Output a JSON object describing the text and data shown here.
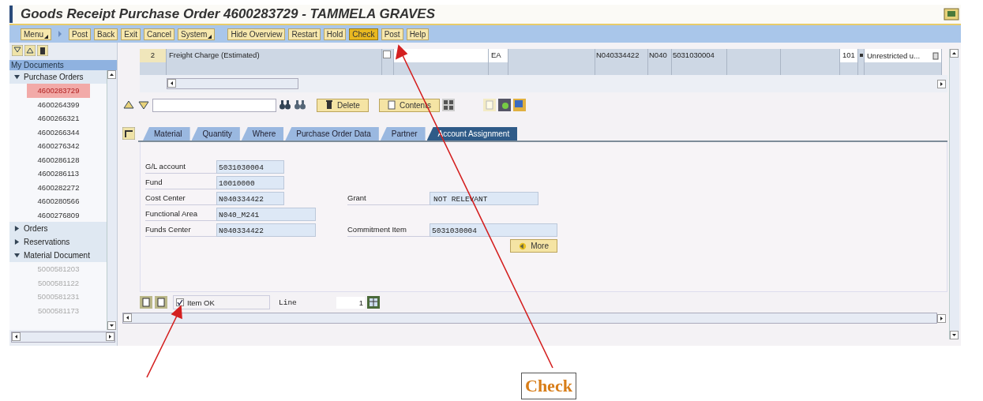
{
  "window": {
    "title": "Goods Receipt Purchase Order 4600283729 - TAMMELA GRAVES"
  },
  "toolbar": [
    {
      "label": "Menu",
      "kind": "menu",
      "selected": false
    },
    {
      "label": "Post",
      "kind": "button",
      "selected": false
    },
    {
      "label": "Back",
      "kind": "button",
      "selected": false
    },
    {
      "label": "Exit",
      "kind": "button",
      "selected": false
    },
    {
      "label": "Cancel",
      "kind": "button",
      "selected": false
    },
    {
      "label": "System",
      "kind": "menu",
      "selected": false
    },
    {
      "label": "Hide Overview",
      "kind": "button",
      "selected": false
    },
    {
      "label": "Restart",
      "kind": "button",
      "selected": false
    },
    {
      "label": "Hold",
      "kind": "button",
      "selected": false
    },
    {
      "label": "Check",
      "kind": "button",
      "selected": true
    },
    {
      "label": "Post",
      "kind": "button",
      "selected": false
    },
    {
      "label": "Help",
      "kind": "button",
      "selected": false
    }
  ],
  "sidebar": {
    "header": "My Documents",
    "tree": [
      {
        "label": "Purchase Orders",
        "expanded": true,
        "children": [
          {
            "label": "4600283729",
            "selected": true,
            "disabled": false
          },
          {
            "label": "4600264399",
            "selected": false,
            "disabled": false
          },
          {
            "label": "4600266321",
            "selected": false,
            "disabled": false
          },
          {
            "label": "4600266344",
            "selected": false,
            "disabled": false
          },
          {
            "label": "4600276342",
            "selected": false,
            "disabled": false
          },
          {
            "label": "4600286128",
            "selected": false,
            "disabled": false
          },
          {
            "label": "4600286113",
            "selected": false,
            "disabled": false
          },
          {
            "label": "4600282272",
            "selected": false,
            "disabled": false
          },
          {
            "label": "4600280566",
            "selected": false,
            "disabled": false
          },
          {
            "label": "4600276809",
            "selected": false,
            "disabled": false
          }
        ]
      },
      {
        "label": "Orders",
        "expanded": false
      },
      {
        "label": "Reservations",
        "expanded": false
      },
      {
        "label": "Material Document",
        "expanded": true,
        "children": [
          {
            "label": "5000581203",
            "selected": false,
            "disabled": true
          },
          {
            "label": "5000581122",
            "selected": false,
            "disabled": true
          },
          {
            "label": "5000581231",
            "selected": false,
            "disabled": true
          },
          {
            "label": "5000581173",
            "selected": false,
            "disabled": true
          }
        ]
      }
    ]
  },
  "item_row": {
    "number": "2",
    "description": "Freight Charge (Estimated)",
    "checked": false,
    "unit": "EA",
    "cost_center": "N040334422",
    "functional_area": "N040",
    "gl_account": "5031030004",
    "movement_type": "101",
    "stock_type": "Unrestricted u..."
  },
  "item_buttons": [
    "Delete",
    "Contents"
  ],
  "tabs": [
    {
      "label": "Material",
      "selected": false
    },
    {
      "label": "Quantity",
      "selected": false
    },
    {
      "label": "Where",
      "selected": false
    },
    {
      "label": "Purchase Order Data",
      "selected": false
    },
    {
      "label": "Partner",
      "selected": false
    },
    {
      "label": "Account Assignment",
      "selected": true
    }
  ],
  "account_assignment": {
    "left": [
      {
        "label": "G/L account",
        "value": "5031030004",
        "kind": "short"
      },
      {
        "label": "Fund",
        "value": "10010000",
        "kind": "short"
      },
      {
        "label": "Cost Center",
        "value": "N040334422",
        "kind": "short"
      },
      {
        "label": "Functional Area",
        "value": "N040_M241",
        "kind": "long"
      },
      {
        "label": "Funds Center",
        "value": "N040334422",
        "kind": "long"
      }
    ],
    "right": [
      {
        "label": "Grant",
        "value": "NOT RELEVANT",
        "kind": "short"
      },
      {
        "label": "Commitment Item",
        "value": "5031030004",
        "kind": "long"
      }
    ],
    "more_button": "More"
  },
  "footer": {
    "item_ok": {
      "label": "Item OK",
      "checked": true
    },
    "line": {
      "label": "Line",
      "value": "1"
    }
  },
  "callout": "Check"
}
